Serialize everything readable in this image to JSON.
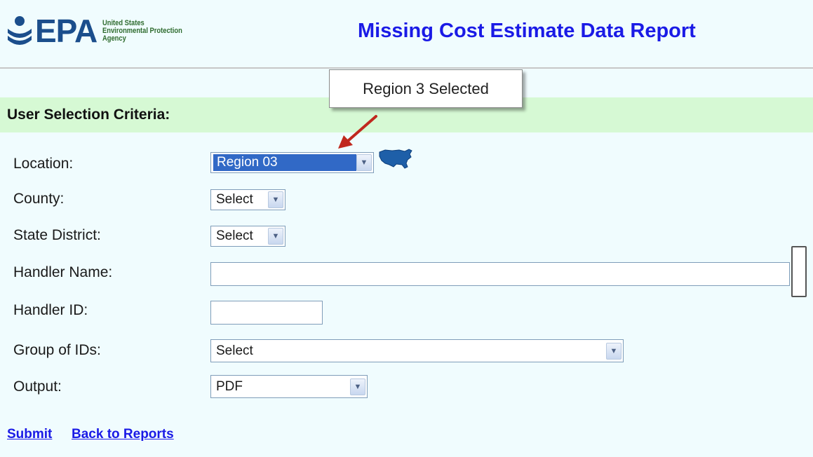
{
  "header": {
    "logo_text": "EPA",
    "agency_lines": [
      "United States",
      "Environmental Protection",
      "Agency"
    ],
    "title": "Missing Cost Estimate Data Report"
  },
  "callout": {
    "text": "Region 3 Selected",
    "arrow_color": "#c0281e"
  },
  "section": {
    "title": "User Selection Criteria:"
  },
  "form": {
    "location": {
      "label": "Location:",
      "value": "Region 03"
    },
    "county": {
      "label": "County:",
      "value": "Select"
    },
    "state_district": {
      "label": "State District:",
      "value": "Select"
    },
    "handler_name": {
      "label": "Handler Name:",
      "value": ""
    },
    "handler_id": {
      "label": "Handler ID:",
      "value": ""
    },
    "group_of_ids": {
      "label": "Group of IDs:",
      "value": "Select"
    },
    "output": {
      "label": "Output:",
      "value": "PDF"
    }
  },
  "links": {
    "submit": "Submit",
    "back": "Back to Reports"
  },
  "colors": {
    "background": "#f0fcfe",
    "section_bar": "#d6f9d4",
    "title_blue": "#1a1ae6",
    "epa_blue": "#1b4e8c",
    "selected_highlight": "#3169c6"
  },
  "icons": {
    "logo": "epa-logo-icon",
    "map": "us-map-icon",
    "dropdown": "chevron-down-icon"
  }
}
